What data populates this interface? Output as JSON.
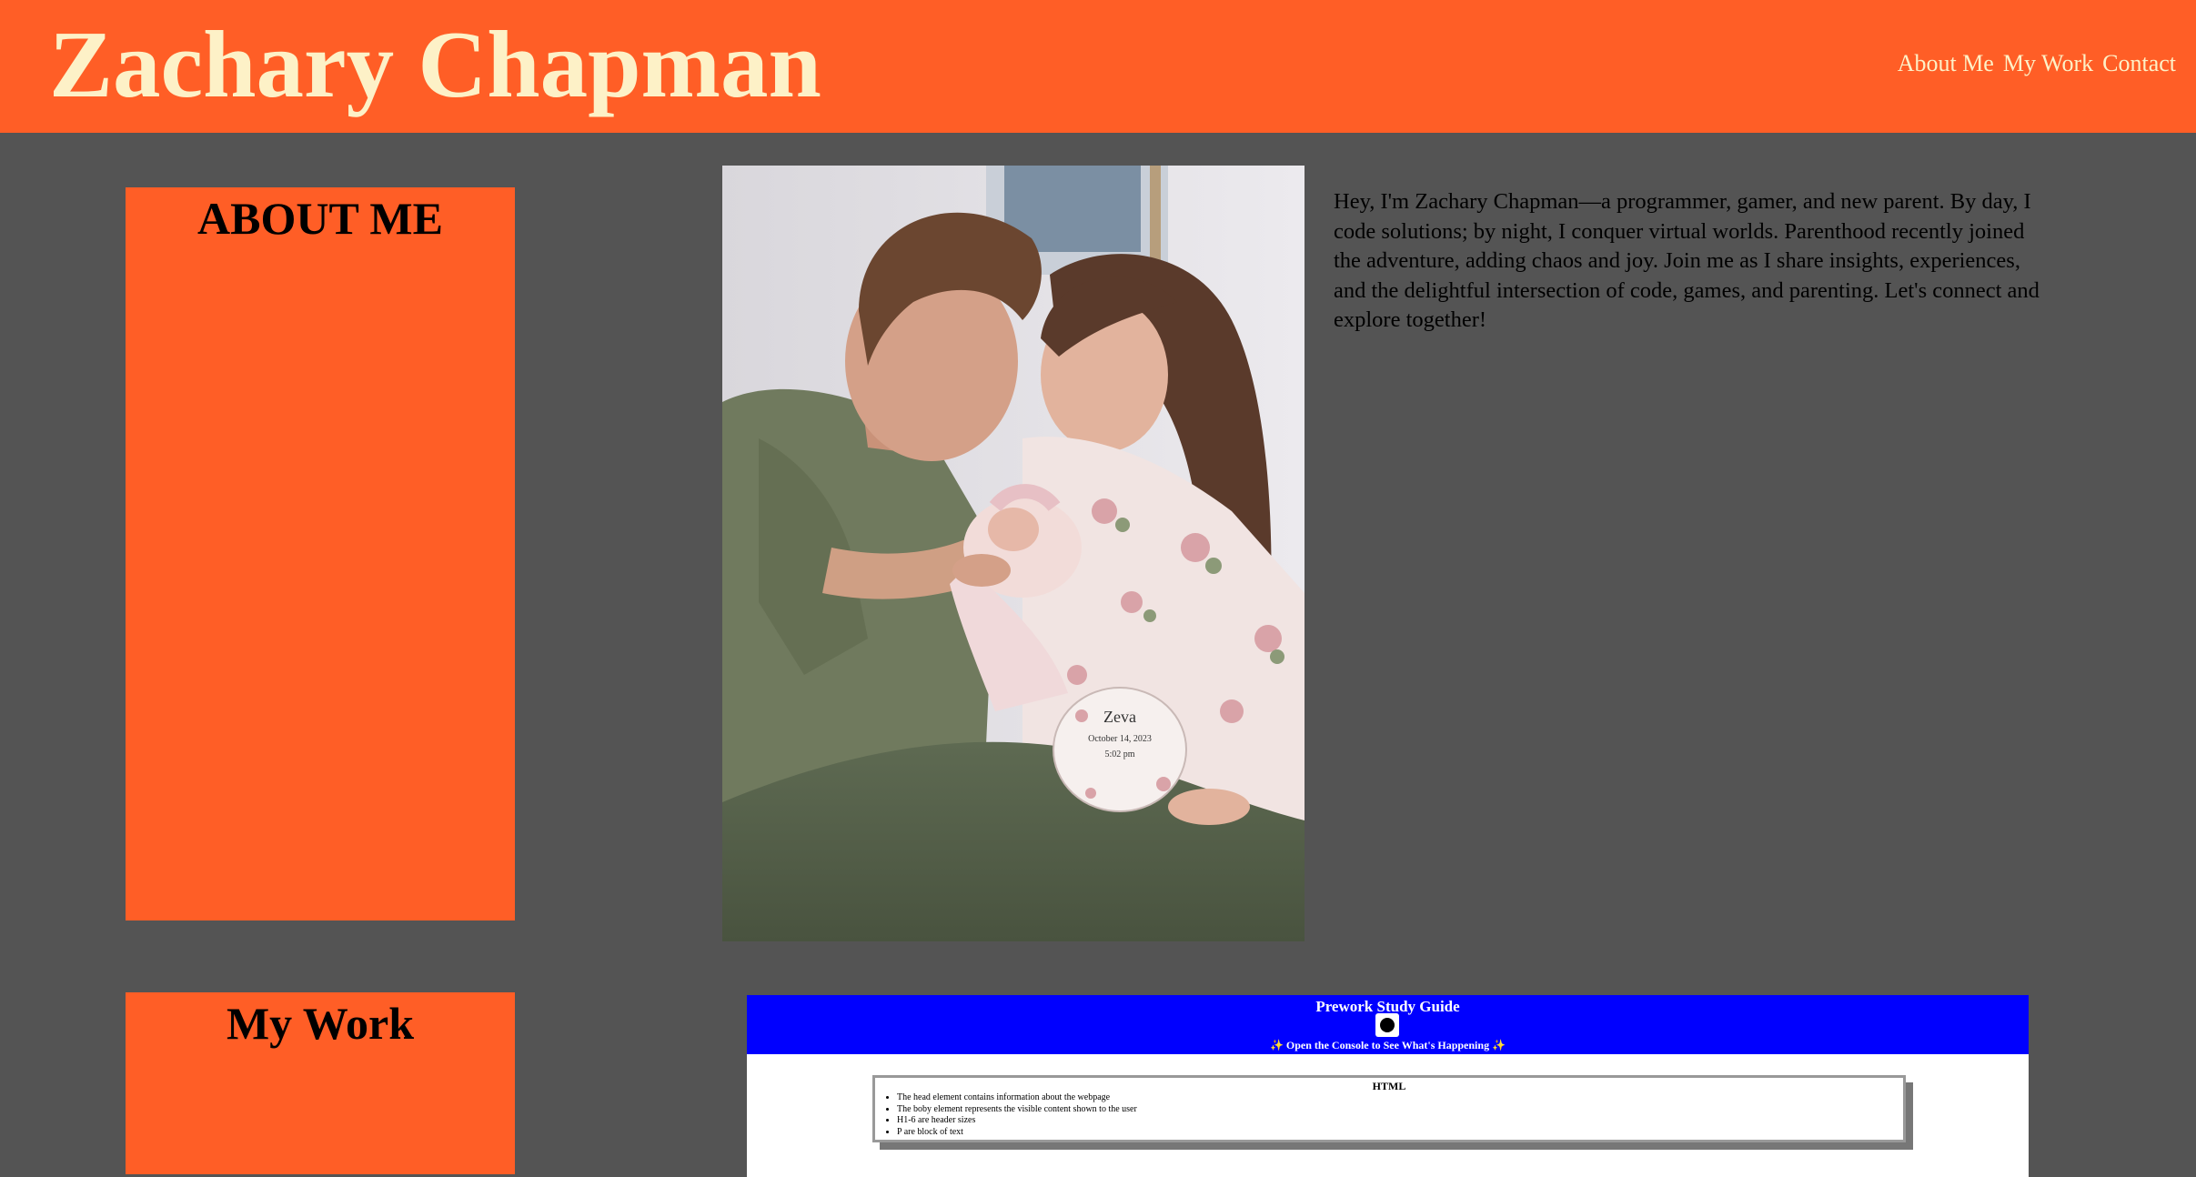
{
  "header": {
    "title": "Zachary Chapman",
    "nav": [
      "About Me",
      "My Work",
      "Contact"
    ]
  },
  "about": {
    "heading": "ABOUT ME",
    "photo_alt": "Family photo with newborn",
    "bio": "Hey, I'm Zachary Chapman—a programmer, gamer, and new parent. By day, I code solutions; by night, I conquer virtual worlds. Parenthood recently joined the adventure, adding chaos and joy. Join me as I share insights, experiences, and the delightful intersection of code, games, and parenting. Let's connect and explore together!",
    "card": {
      "line1": "Zeva",
      "line2": "October 14, 2023",
      "line3": "5:02 pm"
    }
  },
  "work": {
    "heading": "My Work",
    "preview": {
      "title": "Prework Study Guide",
      "subtitle": "✨ Open the Console to See What's Happening ✨",
      "card_title": "HTML",
      "items": [
        "The head element contains information about the webpage",
        "The boby element represents the visible content shown to the user",
        "H1-6 are header sizes",
        "P are block of text"
      ]
    }
  },
  "colors": {
    "accent": "#ff5e26",
    "header_text": "#fdf1c7",
    "background": "#545454",
    "preview_header": "#0000ff"
  }
}
